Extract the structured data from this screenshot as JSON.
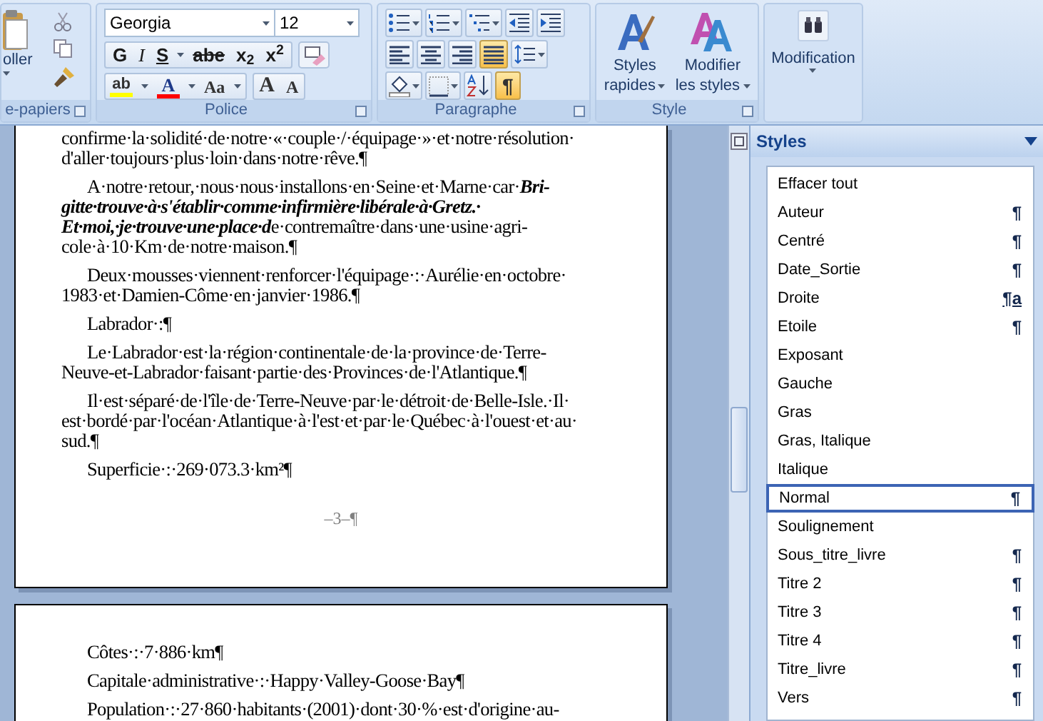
{
  "ribbon": {
    "clipboard": {
      "paste_label": "oller",
      "group_label": "e-papiers"
    },
    "font": {
      "font_name": "Georgia",
      "font_size": "12",
      "format_buttons": [
        {
          "label": "G",
          "kind": "bold"
        },
        {
          "label": "I",
          "kind": "italic"
        },
        {
          "label": "S",
          "kind": "underline"
        },
        {
          "label": "abe",
          "kind": "strike"
        },
        {
          "label": "x$_{2}$",
          "kind": "script"
        },
        {
          "label": "x$^{2}$",
          "kind": "script"
        }
      ],
      "color_buttons": [
        {
          "label": "ab",
          "kind": "highlight",
          "color": "#ffff00"
        },
        {
          "label": "A",
          "kind": "font-color",
          "color": "#ff0000"
        }
      ],
      "case_button": "Aa",
      "size_buttons": [
        {
          "label": "A",
          "kind": "grow"
        },
        {
          "label": "A",
          "kind": "shrink"
        }
      ],
      "group_label": "Police"
    },
    "paragraph": {
      "rows": [
        [
          {
            "kind": "bullets",
            "pressed": false
          },
          {
            "kind": "numbering",
            "pressed": false
          },
          {
            "kind": "multilevel",
            "pressed": false
          },
          {
            "kind": "outdent",
            "pressed": false
          },
          {
            "kind": "indent",
            "pressed": false
          }
        ],
        [
          {
            "kind": "align-left",
            "pressed": false
          },
          {
            "kind": "align-center",
            "pressed": false
          },
          {
            "kind": "align-right",
            "pressed": false
          },
          {
            "kind": "justify",
            "pressed": true
          },
          {
            "kind": "line-spacing",
            "pressed": false
          }
        ],
        [
          {
            "kind": "shading",
            "pressed": false
          },
          {
            "kind": "borders",
            "pressed": false
          },
          {
            "kind": "sort",
            "pressed": false
          },
          {
            "kind": "pilcrow",
            "label": "¶",
            "pressed": true
          }
        ]
      ],
      "group_label": "Paragraphe"
    },
    "style": {
      "buttons": [
        {
          "kind": "quick-styles",
          "lines": [
            "Styles",
            "rapides"
          ]
        },
        {
          "kind": "change-styles",
          "lines": [
            "Modifier",
            "les styles"
          ]
        }
      ],
      "group_label": "Style"
    },
    "editing": {
      "label": "Modification"
    }
  },
  "document": {
    "pages": [
      {
        "paragraphs": [
          {
            "indent": false,
            "lines": [
              [
                {
                  "text": "confirme·la·solidité·de·notre·«·couple·/·équipage·»·et·notre·résolution·",
                  "bold_italic": false
                }
              ],
              [
                {
                  "text": "d'aller·toujours·plus·loin·dans·notre·rêve.¶",
                  "bold_italic": false
                }
              ]
            ]
          },
          {
            "indent": true,
            "lines": [
              [
                {
                  "text": "A·notre·retour,·nous·nous·installons·en·Seine·et·Marne·car·",
                  "bold_italic": false
                },
                {
                  "text": "Bri-",
                  "bold_italic": true
                }
              ],
              [
                {
                  "text": "gitte·trouve·à·s'établir·comme·infirmière·libérale·à·Gretz.·",
                  "bold_italic": true
                }
              ],
              [
                {
                  "text": "Et·moi,·je·trouve·une·place·d",
                  "bold_italic": true
                },
                {
                  "text": "e·contremaître·dans·une·usine·agri-",
                  "bold_italic": false
                }
              ],
              [
                {
                  "text": "cole·à·10·Km·de·notre·maison.¶",
                  "bold_italic": false
                }
              ]
            ]
          },
          {
            "indent": true,
            "lines": [
              [
                {
                  "text": "Deux·mousses·viennent·renforcer·l'équipage·:·Aurélie·en·octobre·",
                  "bold_italic": false
                }
              ],
              [
                {
                  "text": "1983·et·Damien-Côme·en·janvier·1986.¶",
                  "bold_italic": false
                }
              ]
            ]
          },
          {
            "indent": true,
            "lines": [
              [
                {
                  "text": "Labrador·:¶",
                  "bold_italic": false
                }
              ]
            ]
          },
          {
            "indent": true,
            "lines": [
              [
                {
                  "text": "Le·Labrador·est·la·région·continentale·de·la·province·de·Terre-",
                  "bold_italic": false
                }
              ],
              [
                {
                  "text": "Neuve-et-Labrador·faisant·partie·des·Provinces·de·l'Atlantique.¶",
                  "bold_italic": false
                }
              ]
            ]
          },
          {
            "indent": true,
            "lines": [
              [
                {
                  "text": "Il·est·séparé·de·l'île·de·Terre-Neuve·par·le·détroit·de·Belle-Isle.·Il·",
                  "bold_italic": false
                }
              ],
              [
                {
                  "text": "est·bordé·par·l'océan·Atlantique·à·l'est·et·par·le·Québec·à·l'ouest·et·au·",
                  "bold_italic": false
                }
              ],
              [
                {
                  "text": "sud.¶",
                  "bold_italic": false
                }
              ]
            ]
          },
          {
            "indent": true,
            "lines": [
              [
                {
                  "text": "Superficie·:·269·073.3·km²¶",
                  "bold_italic": false
                }
              ]
            ]
          }
        ],
        "footer": "–3–¶"
      },
      {
        "paragraphs": [
          {
            "indent": true,
            "lines": [
              [
                {
                  "text": "Côtes·:·7·886·km¶",
                  "bold_italic": false
                }
              ]
            ]
          },
          {
            "indent": true,
            "lines": [
              [
                {
                  "text": "Capitale·administrative·:·Happy·Valley-Goose·Bay¶",
                  "bold_italic": false
                }
              ]
            ]
          },
          {
            "indent": true,
            "lines": [
              [
                {
                  "text": "Population·:·27·860·habitants·(2001)·dont·30·%·est·d'origine·au-",
                  "bold_italic": false
                }
              ]
            ]
          }
        ]
      }
    ]
  },
  "styles_pane": {
    "title": "Styles",
    "items": [
      {
        "label": "Effacer tout",
        "selected": false
      },
      {
        "label": "Auteur",
        "symbol": "¶",
        "selected": false
      },
      {
        "label": "Centré",
        "symbol": "¶",
        "selected": false
      },
      {
        "label": "Date_Sortie",
        "symbol": "¶",
        "selected": false
      },
      {
        "label": "Droite",
        "symbol": "¶a",
        "selected": false
      },
      {
        "label": "Etoile",
        "symbol": "¶",
        "selected": false
      },
      {
        "label": "Exposant",
        "selected": false
      },
      {
        "label": "Gauche",
        "selected": false
      },
      {
        "label": "Gras",
        "selected": false
      },
      {
        "label": "Gras, Italique",
        "selected": false
      },
      {
        "label": "Italique",
        "selected": false
      },
      {
        "label": "Normal",
        "symbol": "¶",
        "selected": true
      },
      {
        "label": "Soulignement",
        "selected": false
      },
      {
        "label": "Sous_titre_livre",
        "symbol": "¶",
        "selected": false
      },
      {
        "label": "Titre 2",
        "symbol": "¶",
        "selected": false
      },
      {
        "label": "Titre 3",
        "symbol": "¶",
        "selected": false
      },
      {
        "label": "Titre 4",
        "symbol": "¶",
        "selected": false
      },
      {
        "label": "Titre_livre",
        "symbol": "¶",
        "selected": false
      },
      {
        "label": "Vers",
        "symbol": "¶",
        "selected": false
      }
    ]
  }
}
